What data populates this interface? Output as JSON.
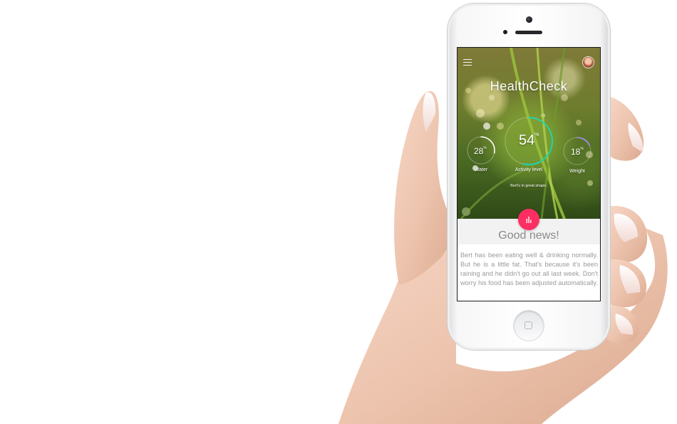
{
  "app": {
    "title": "HealthCheck"
  },
  "header": {
    "menu_icon": "hamburger-menu-icon",
    "avatar_icon": "user-avatar"
  },
  "metrics": {
    "water": {
      "value": "28",
      "unit": "%",
      "label": "Water",
      "level": 0.28,
      "color": "#ffffff"
    },
    "activity": {
      "value": "54",
      "unit": "%",
      "label": "Activity level",
      "level": 0.54,
      "color": "#1fd3b0"
    },
    "weight": {
      "value": "18",
      "unit": "%",
      "label": "Weight",
      "level": 0.18,
      "color": "#a98bff"
    }
  },
  "status_text": "Bert's in great shape.",
  "fab": {
    "icon": "bar-chart-icon",
    "color": "#ff2e62"
  },
  "news": {
    "title": "Good news!",
    "body": "Bert has been eating well & drinking normally. But he is a little fat. That's because it's been raining and he didn't go out all last week. Don't worry his food has been adjusted automatically."
  }
}
